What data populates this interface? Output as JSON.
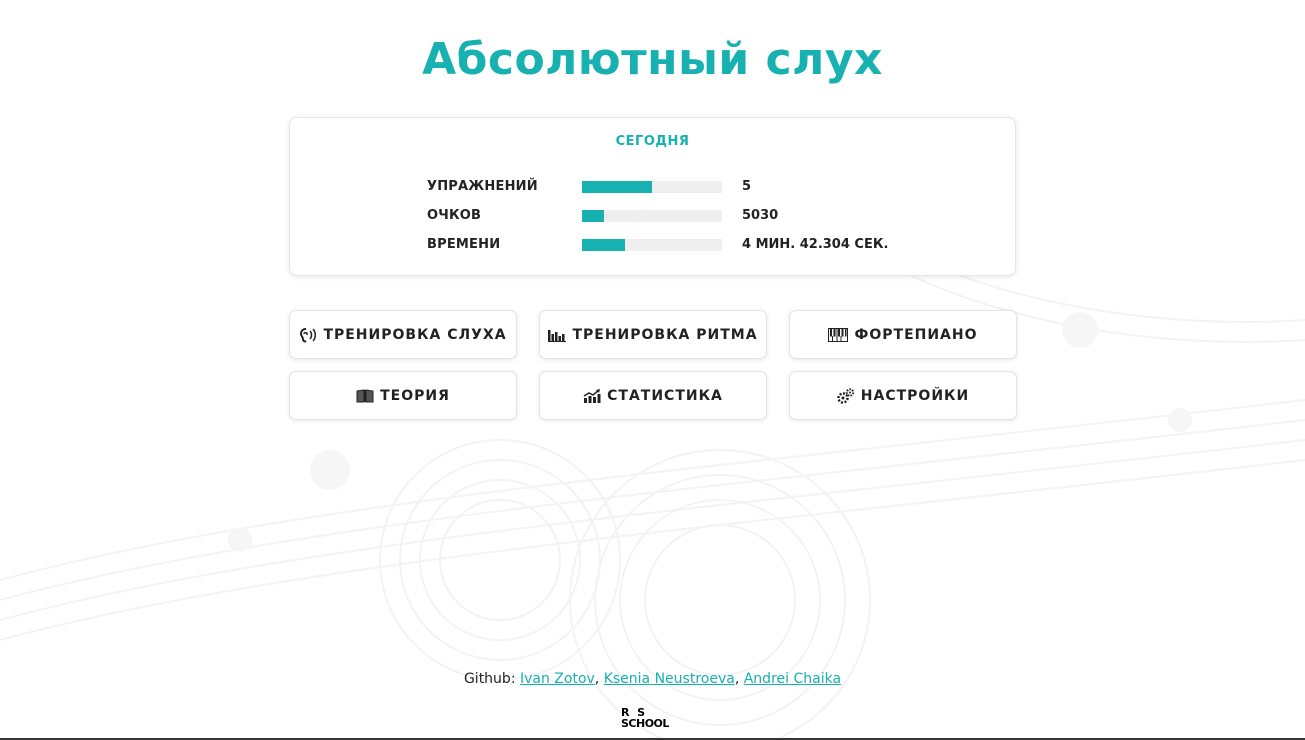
{
  "app": {
    "title": "Абсолютный слух"
  },
  "stats": {
    "heading": "СЕГОДНЯ",
    "rows": [
      {
        "label": "УПРАЖНЕНИЙ",
        "value": "5",
        "fill_percent": 50
      },
      {
        "label": "ОЧКОВ",
        "value": "5030",
        "fill_percent": 16
      },
      {
        "label": "ВРЕМЕНИ",
        "value": "4 МИН. 42.304 СЕК.",
        "fill_percent": 31
      }
    ]
  },
  "menu": {
    "ear_training": {
      "label": "ТРЕНИРОВКА СЛУХА",
      "icon": "ear-sound-icon"
    },
    "rhythm_training": {
      "label": "ТРЕНИРОВКА РИТМА",
      "icon": "equalizer-icon"
    },
    "piano": {
      "label": "ФОРТЕПИАНО",
      "icon": "piano-keys-icon"
    },
    "theory": {
      "label": "ТЕОРИЯ",
      "icon": "open-book-icon"
    },
    "statistics": {
      "label": "СТАТИСТИКА",
      "icon": "chart-growth-icon"
    },
    "settings": {
      "label": "НАСТРОЙКИ",
      "icon": "gears-icon"
    }
  },
  "footer": {
    "prefix": "Github: ",
    "authors": [
      "Ivan Zotov",
      "Ksenia Neustroeva",
      "Andrei Chaika"
    ],
    "separator": ", ",
    "logo_line1": "R  S",
    "logo_line2": "SCHOOL"
  },
  "colors": {
    "accent": "#16b1b0",
    "bar_track": "#efefef",
    "text": "#222222"
  }
}
